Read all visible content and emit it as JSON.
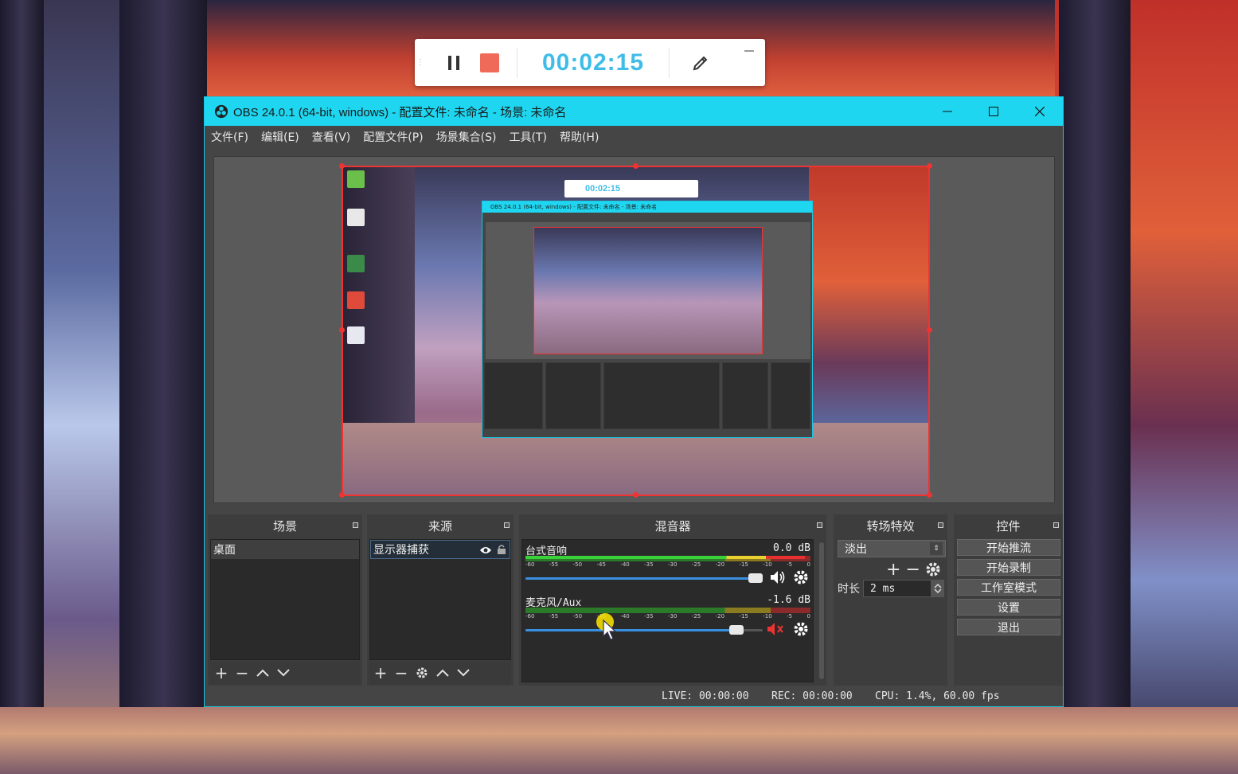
{
  "recorder": {
    "elapsed": "00:02:15",
    "icons": {
      "pause": "pause-icon",
      "stop": "stop-icon",
      "pen": "pen-icon",
      "minimize": "minimize-icon"
    }
  },
  "window": {
    "title": "OBS 24.0.1 (64-bit, windows) - 配置文件: 未命名 - 场景: 未命名",
    "accent": "#1fd6f0"
  },
  "menu": [
    "文件(F)",
    "编辑(E)",
    "查看(V)",
    "配置文件(P)",
    "场景集合(S)",
    "工具(T)",
    "帮助(H)"
  ],
  "docks": {
    "scenes": {
      "title": "场景",
      "items": [
        "桌面"
      ]
    },
    "sources": {
      "title": "来源",
      "items": [
        "显示器捕获"
      ]
    },
    "mixer": {
      "title": "混音器",
      "ticks": [
        "-60",
        "-55",
        "-50",
        "-45",
        "-40",
        "-35",
        "-30",
        "-25",
        "-20",
        "-15",
        "-10",
        "-5",
        "0"
      ],
      "tracks": [
        {
          "name": "台式音响",
          "db": "0.0 dB",
          "volume": 0.97,
          "muted": false
        },
        {
          "name": "麦克风/Aux",
          "db": "-1.6 dB",
          "volume": 0.9,
          "muted": true
        }
      ]
    },
    "transitions": {
      "title": "转场特效",
      "selected": "淡出",
      "duration_label": "时长",
      "duration_value": "2 ms"
    },
    "controls": {
      "title": "控件",
      "buttons": [
        "开始推流",
        "开始录制",
        "工作室模式",
        "设置",
        "退出"
      ]
    }
  },
  "status": {
    "live": "LIVE: 00:00:00",
    "rec": "REC: 00:00:00",
    "cpu": "CPU: 1.4%, 60.00 fps"
  },
  "preview": {
    "nested_time": "00:02:15",
    "nested_title": "OBS 24.0.1 (64-bit, windows) - 配置文件: 未命名 - 场景: 未命名"
  }
}
